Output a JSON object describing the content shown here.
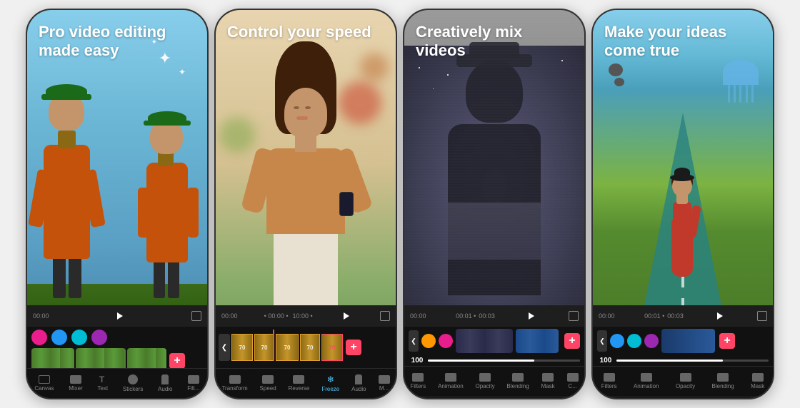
{
  "screens": [
    {
      "id": "screen1",
      "title": "Pro video editing made easy",
      "toolbar_items": [
        "Canvas",
        "Mixer",
        "Text",
        "Stickers",
        "Audio",
        "Filt..."
      ],
      "time": "00:00",
      "stickers": [
        "pink",
        "blue",
        "teal",
        "purple"
      ],
      "clip_colors": [
        "green",
        "green",
        "green"
      ]
    },
    {
      "id": "screen2",
      "title": "Control your speed",
      "toolbar_items": [
        "Transform",
        "Speed",
        "Reverse",
        "Freeze",
        "Audio",
        "M..."
      ],
      "time": "00:00",
      "clip_type": "speed"
    },
    {
      "id": "screen3",
      "title": "Creatively mix videos",
      "toolbar_items": [
        "Filters",
        "Animation",
        "Opacity",
        "Blending",
        "Mask",
        "C..."
      ],
      "time": "00:00",
      "opacity_value": "100",
      "stickers": [
        "orange",
        "pink"
      ]
    },
    {
      "id": "screen4",
      "title": "Make your ideas come true",
      "toolbar_items": [
        "Filters",
        "Animation",
        "Opacity",
        "Blending",
        "Mask"
      ],
      "time": "00:00",
      "opacity_value": "100",
      "stickers": [
        "blue",
        "teal",
        "purple"
      ]
    }
  ],
  "icons": {
    "play": "▶",
    "add": "+",
    "scroll_left": "❮",
    "freeze_icon": "❄"
  }
}
